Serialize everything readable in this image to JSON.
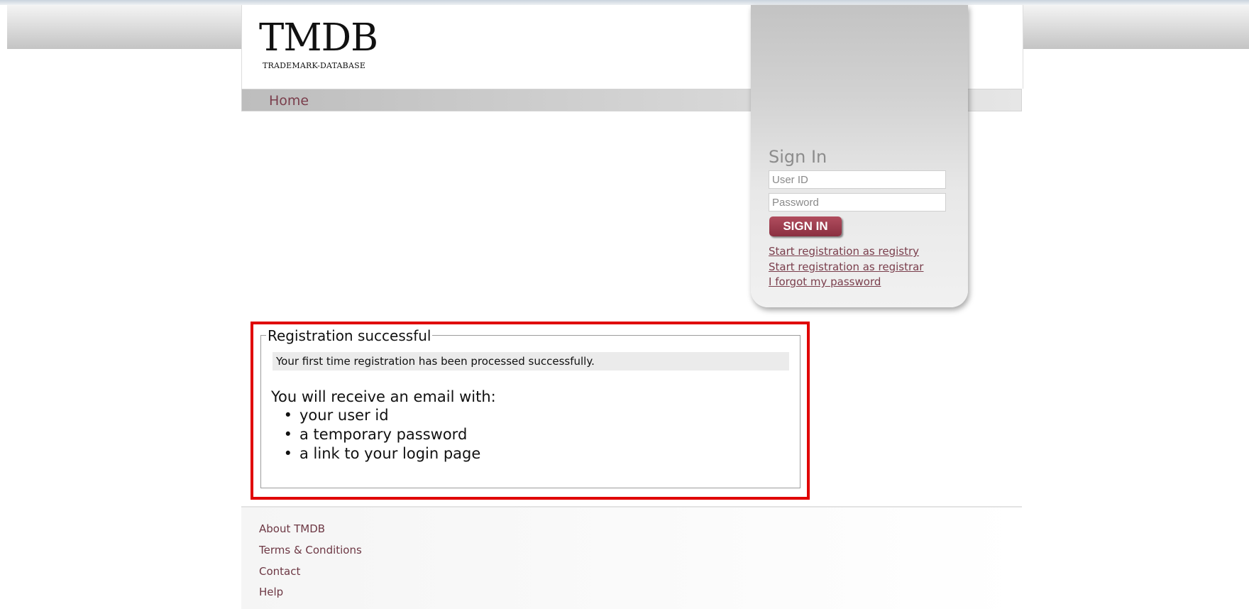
{
  "brand": {
    "logo_main": "TMDB",
    "logo_sub": "TRADEMARK-DATABASE"
  },
  "nav": {
    "home_label": "Home"
  },
  "signin": {
    "title": "Sign In",
    "user_placeholder": "User ID",
    "password_placeholder": "Password",
    "button_label": "SIGN IN",
    "links": [
      "Start registration as registry",
      "Start registration as registrar",
      "I forgot my password"
    ]
  },
  "registration": {
    "legend": "Registration successful",
    "success_message": "Your first time registration has been processed successfully.",
    "email_intro": "You will receive an email with:",
    "email_items": [
      "your user id",
      "a temporary password",
      "a link to your login page"
    ]
  },
  "footer": {
    "links": [
      "About TMDB",
      "Terms & Conditions",
      "Contact",
      "Help"
    ]
  },
  "colors": {
    "accent": "#7a3e4c",
    "button": "#9c3c4d",
    "highlight_border": "#e00000"
  }
}
